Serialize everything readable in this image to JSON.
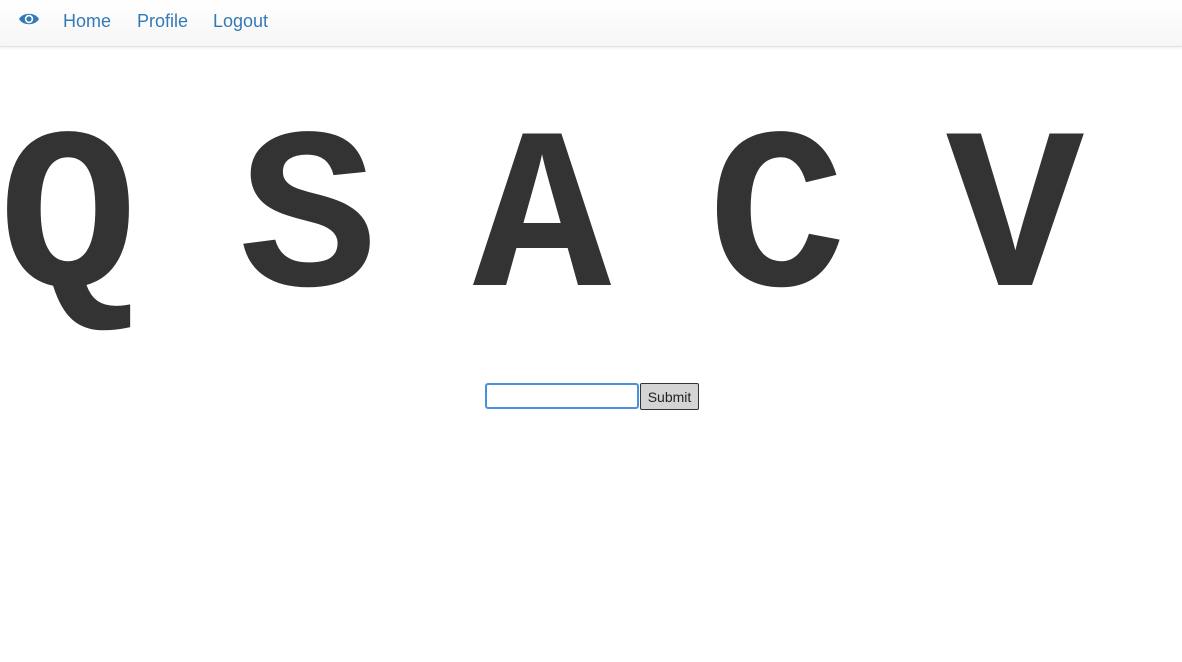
{
  "nav": {
    "brand_icon": "eye-icon",
    "link_color": "#337ab7",
    "links": [
      "Home",
      "Profile",
      "Logout"
    ]
  },
  "captcha": {
    "letters": [
      "Q",
      "S",
      "A",
      "C",
      "V"
    ],
    "letter_color": "#333333"
  },
  "form": {
    "input_value": "",
    "submit_label": "Submit"
  }
}
